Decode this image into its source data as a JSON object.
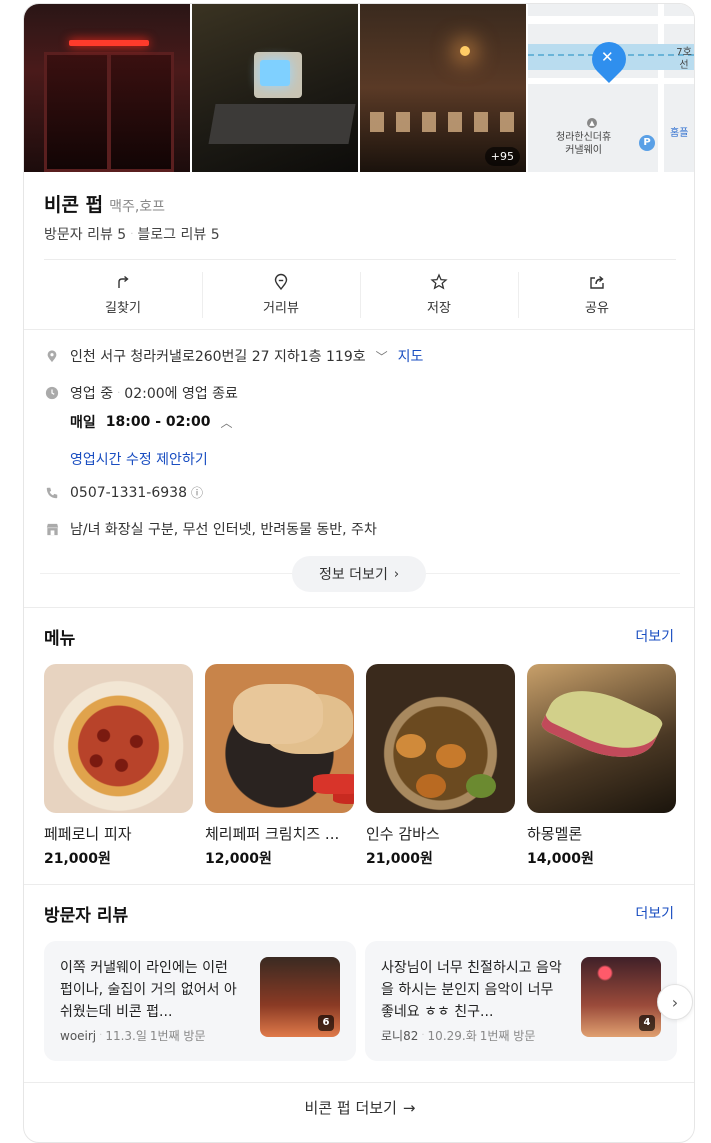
{
  "photos": {
    "count_badge": "+95",
    "map": {
      "road_label": "7호선",
      "building_label": "청라한신더휴\n커낼웨이",
      "right_label": "홈플",
      "parking": "P"
    }
  },
  "place": {
    "name": "비콘 펍",
    "category": "맥주,호프",
    "visitor_reviews": "방문자 리뷰 5",
    "blog_reviews": "블로그 리뷰 5"
  },
  "actions": [
    {
      "label": "길찾기",
      "icon": "directions-icon"
    },
    {
      "label": "거리뷰",
      "icon": "street-view-icon"
    },
    {
      "label": "저장",
      "icon": "star-icon"
    },
    {
      "label": "공유",
      "icon": "share-icon"
    }
  ],
  "info": {
    "address": "인천 서구 청라커낼로260번길 27 지하1층 119호",
    "map_link": "지도",
    "status": "영업 중",
    "close_time": "02:00에 영업 종료",
    "hours_day": "매일",
    "hours_range": "18:00 - 02:00",
    "suggest_hours": "영업시간 수정 제안하기",
    "phone": "0507-1331-6938",
    "amenities": "남/녀 화장실 구분, 무선 인터넷, 반려동물 동반, 주차",
    "more_info": "정보 더보기"
  },
  "menu": {
    "title": "메뉴",
    "more": "더보기",
    "items": [
      {
        "name": "페페로니 피자",
        "price": "21,000원"
      },
      {
        "name": "체리페퍼 크림치즈 ...",
        "price": "12,000원"
      },
      {
        "name": "인수 감바스",
        "price": "21,000원"
      },
      {
        "name": "하몽멜론",
        "price": "14,000원"
      }
    ]
  },
  "reviews": {
    "title": "방문자 리뷰",
    "more": "더보기",
    "items": [
      {
        "text": "이쪽 커낼웨이 라인에는 이런 펍이나, 술집이 거의 없어서 아쉬웠는데 비콘 펍...",
        "author": "woeirj",
        "date": "11.3.일",
        "visit": "1번째 방문",
        "photo_count": "6"
      },
      {
        "text": "사장님이 너무 친절하시고 음악을 하시는 분인지 음악이 너무 좋네요 ㅎㅎ 친구...",
        "author": "로니82",
        "date": "10.29.화",
        "visit": "1번째 방문",
        "photo_count": "4"
      }
    ]
  },
  "footer": {
    "more_label": "비콘 펍 더보기"
  },
  "colors": {
    "link": "#1a4ec1",
    "map_pin": "#2f8fee"
  }
}
